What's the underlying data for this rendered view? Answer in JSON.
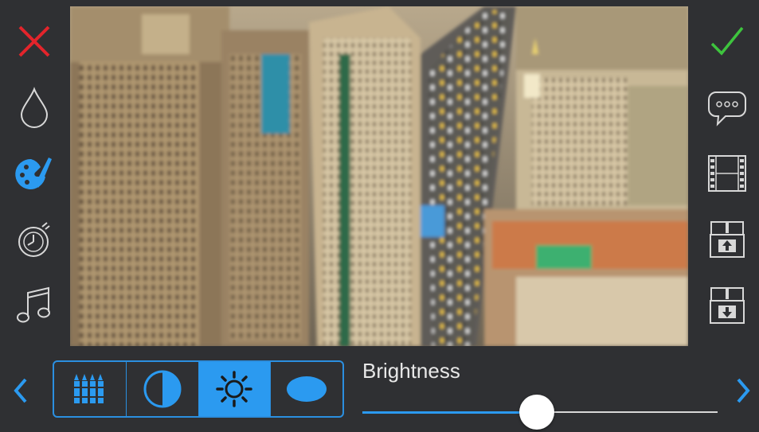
{
  "left_toolbar": {
    "items": [
      {
        "icon": "close-icon"
      },
      {
        "icon": "drop-icon"
      },
      {
        "icon": "palette-icon",
        "selected": true
      },
      {
        "icon": "timer-icon"
      },
      {
        "icon": "music-note-icon"
      }
    ]
  },
  "right_toolbar": {
    "items": [
      {
        "icon": "checkmark-icon"
      },
      {
        "icon": "speech-bubble-icon"
      },
      {
        "icon": "film-strip-icon"
      },
      {
        "icon": "box-upload-icon"
      },
      {
        "icon": "box-download-icon"
      }
    ]
  },
  "tools": [
    {
      "icon": "crayons-icon"
    },
    {
      "icon": "contrast-icon"
    },
    {
      "icon": "sun-icon",
      "selected": true
    },
    {
      "icon": "ellipse-vignette-icon"
    }
  ],
  "adjustment": {
    "label": "Brightness",
    "value": 0.49
  },
  "colors": {
    "accent": "#2b9af0",
    "close": "#e3242b",
    "confirm": "#3ec43e",
    "background": "#2f3033"
  }
}
